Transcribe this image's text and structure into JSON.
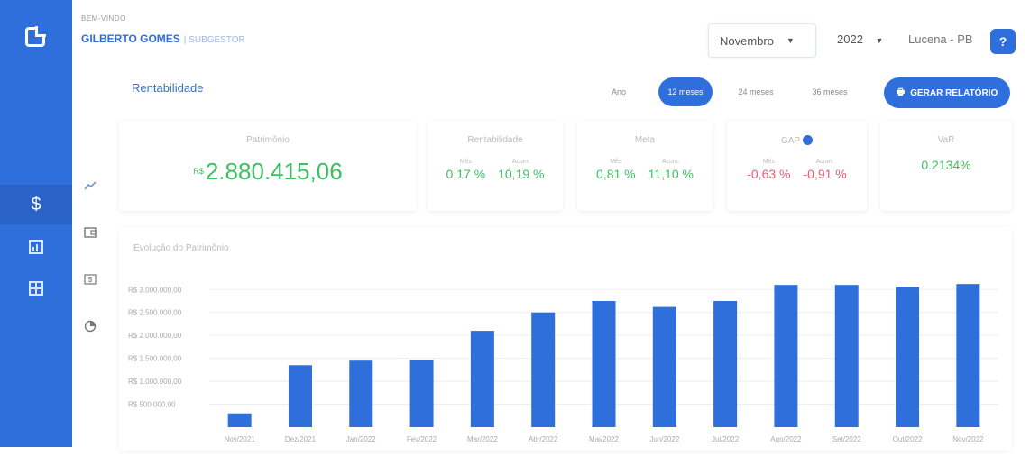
{
  "header": {
    "welcome": "BEM-VINDO",
    "user_name": "GILBERTO GOMES",
    "user_role": "| SUBGESTOR",
    "month": "Novembro",
    "year": "2022",
    "city": "Lucena - PB",
    "help_icon": "?"
  },
  "section": {
    "title": "Rentabilidade",
    "filters": [
      "Ano",
      "12 meses",
      "24 meses",
      "36 meses"
    ],
    "active_filter": "12 meses",
    "report_button": "GERAR RELATÓRIO"
  },
  "cards": {
    "patrimonio": {
      "title": "Patrimônio",
      "currency": "R$",
      "value": "2.880.415,06"
    },
    "rentabilidade": {
      "title": "Rentabilidade",
      "mes_label": "Mês",
      "acum_label": "Acum.",
      "mes": "0,17 %",
      "acum": "10,19 %"
    },
    "meta": {
      "title": "Meta",
      "mes_label": "Mês",
      "acum_label": "Acum.",
      "mes": "0,81 %",
      "acum": "11,10 %"
    },
    "gap": {
      "title": "GAP",
      "mes_label": "Mês",
      "acum_label": "Acum.",
      "mes": "-0,63 %",
      "acum": "-0,91 %"
    },
    "var": {
      "title": "VaR",
      "value": "0.2134%"
    }
  },
  "colors": {
    "accent": "#2f6fdb",
    "positive": "#3fbf62",
    "negative": "#ee5b72"
  },
  "chart_data": {
    "type": "bar",
    "title": "Evolução do Patrimônio",
    "categories": [
      "Nov/2021",
      "Dez/2021",
      "Jan/2022",
      "Fev/2022",
      "Mar/2022",
      "Abr/2022",
      "Mai/2022",
      "Jun/2022",
      "Jul/2022",
      "Ago/2022",
      "Set/2022",
      "Out/2022",
      "Nov/2022"
    ],
    "values": [
      300000,
      1350000,
      1450000,
      1460000,
      2100000,
      2500000,
      2750000,
      2620000,
      2750000,
      3100000,
      3100000,
      3060000,
      3120000
    ],
    "y_ticks": [
      "R$ 500.000,00",
      "R$ 1.000.000,00",
      "R$ 1.500.000,00",
      "R$ 2.000.000,00",
      "R$ 2.500.000,00",
      "R$ 3.000.000,00"
    ],
    "y_tick_values": [
      0,
      500000,
      1000000,
      1500000,
      2000000,
      2500000,
      3000000
    ],
    "y_tick_labels": [
      "R$ 500.000,00",
      "R$ 1.000.000,00",
      "R$ 1.500.000,00",
      "R$ 2.000.000,00",
      "R$ 2.500.000,00",
      "R$ 3.000.000,00"
    ],
    "ylim": [
      0,
      3300000
    ],
    "bar_color": "#2f6fdb",
    "grid": true
  },
  "icons": {
    "sidebar": [
      "logo-icon",
      "dollar-icon",
      "bar-chart-icon",
      "table-icon"
    ],
    "subnav": [
      "trend-line-icon",
      "wallet-icon",
      "cash-icon",
      "pie-chart-icon"
    ]
  }
}
